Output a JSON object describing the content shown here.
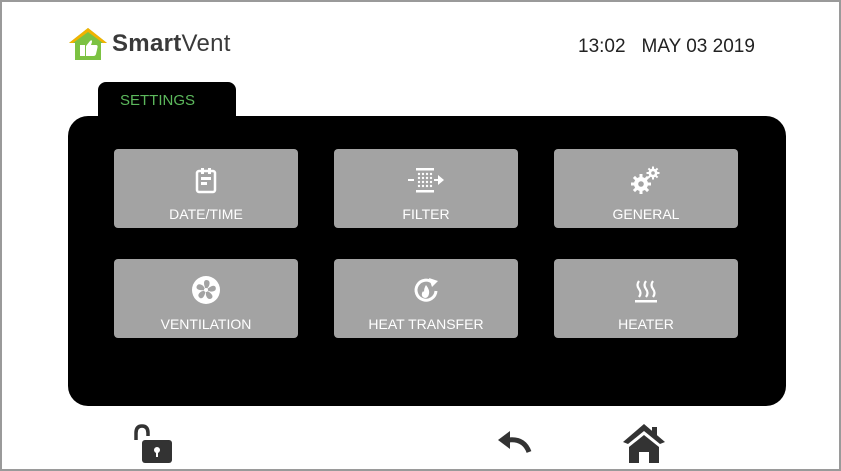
{
  "brand": {
    "name_bold": "Smart",
    "name_regular": "Vent"
  },
  "header": {
    "time": "13:02",
    "date": "MAY 03 2019"
  },
  "tabs": [
    {
      "label": "SETTINGS",
      "active": true
    }
  ],
  "settings": {
    "tiles": [
      {
        "label": "DATE/TIME",
        "icon": "calendar-icon"
      },
      {
        "label": "FILTER",
        "icon": "filter-icon"
      },
      {
        "label": "GENERAL",
        "icon": "gears-icon"
      },
      {
        "label": "VENTILATION",
        "icon": "fan-icon"
      },
      {
        "label": "HEAT TRANSFER",
        "icon": "heat-transfer-icon"
      },
      {
        "label": "HEATER",
        "icon": "heater-icon"
      }
    ]
  },
  "footer": {
    "icons": [
      "unlock-icon",
      "back-icon",
      "home-icon"
    ]
  },
  "colors": {
    "accent": "#5cb85c",
    "panel": "#000000",
    "tile": "#a3a3a3",
    "text": "#ffffff"
  }
}
